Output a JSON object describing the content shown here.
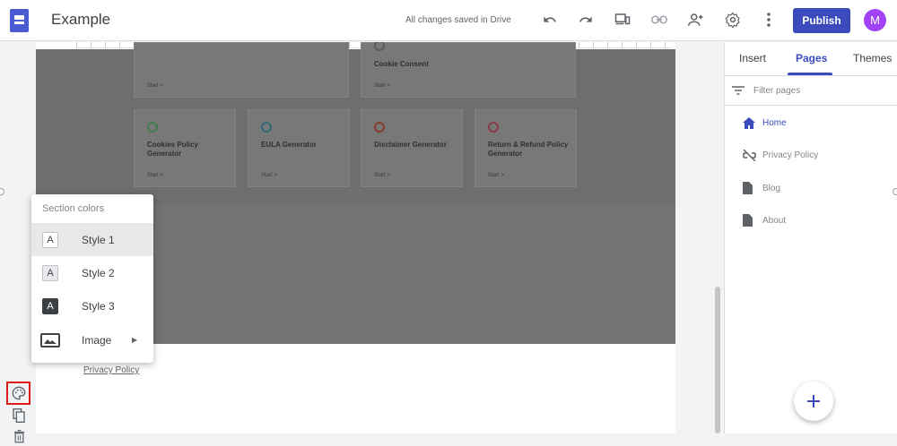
{
  "header": {
    "title": "Example",
    "saved_status": "All changes saved in Drive",
    "publish_label": "Publish",
    "avatar_initial": "M"
  },
  "canvas": {
    "cards": [
      {
        "title": "Cookie Consent",
        "start": "Start >"
      },
      {
        "title": "Cookies Policy Generator",
        "start": "Start >"
      },
      {
        "title": "EULA Generator",
        "start": "Start >"
      },
      {
        "title": "Disclaimer Generator",
        "start": "Start >"
      },
      {
        "title": "Return & Refund Policy Generator",
        "start": "Start >"
      }
    ],
    "top_card_start": "Start >",
    "footer_link": "Privacy Policy"
  },
  "popup": {
    "header": "Section colors",
    "items": [
      {
        "icon": "A",
        "label": "Style 1"
      },
      {
        "icon": "A",
        "label": "Style 2"
      },
      {
        "icon": "A",
        "label": "Style 3"
      },
      {
        "icon": "image-icon",
        "label": "Image"
      }
    ]
  },
  "right_panel": {
    "tabs": [
      "Insert",
      "Pages",
      "Themes"
    ],
    "active_tab": "Pages",
    "filter_placeholder": "Filter pages",
    "pages": [
      {
        "label": "Home",
        "icon": "home-icon"
      },
      {
        "label": "Privacy Policy",
        "icon": "hidden-link-icon"
      },
      {
        "label": "Blog",
        "icon": "page-icon"
      },
      {
        "label": "About",
        "icon": "page-icon"
      }
    ]
  },
  "colors": {
    "accent": "#3b4bbd",
    "avatar": "#a142f4",
    "highlight_box": "#e01b1b",
    "dark_section": "#6e6e6e"
  }
}
